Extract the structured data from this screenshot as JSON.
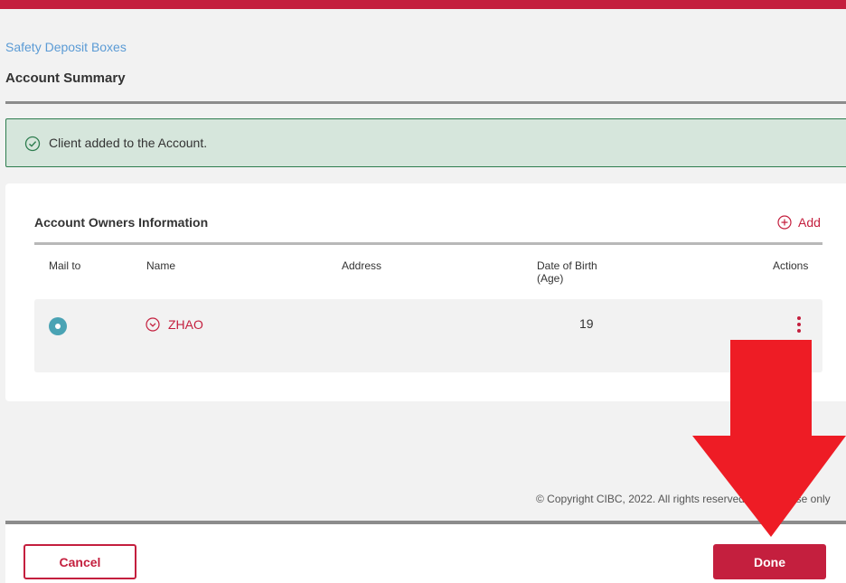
{
  "breadcrumb": {
    "label": "Safety Deposit Boxes"
  },
  "page": {
    "title": "Account Summary"
  },
  "alert": {
    "message": "Client added to the Account.",
    "icon": "check-circle-icon",
    "color": "#2e7d4f"
  },
  "owners": {
    "title": "Account Owners Information",
    "add_label": "Add",
    "columns": {
      "mail_to": "Mail to",
      "name": "Name",
      "address": "Address",
      "dob_line1": "Date of Birth",
      "dob_line2": "(Age)",
      "actions": "Actions"
    },
    "rows": [
      {
        "mail_to_selected": true,
        "name": "ZHAO",
        "address": "",
        "age": "19"
      }
    ]
  },
  "copyright": "© Copyright CIBC, 2022. All rights reserved. Internal use only",
  "footer": {
    "cancel_label": "Cancel",
    "done_label": "Done"
  },
  "colors": {
    "brand": "#c41f3e",
    "link": "#5b9bd5",
    "radio": "#4aa3b4",
    "annotation_arrow": "#ee1c25"
  }
}
